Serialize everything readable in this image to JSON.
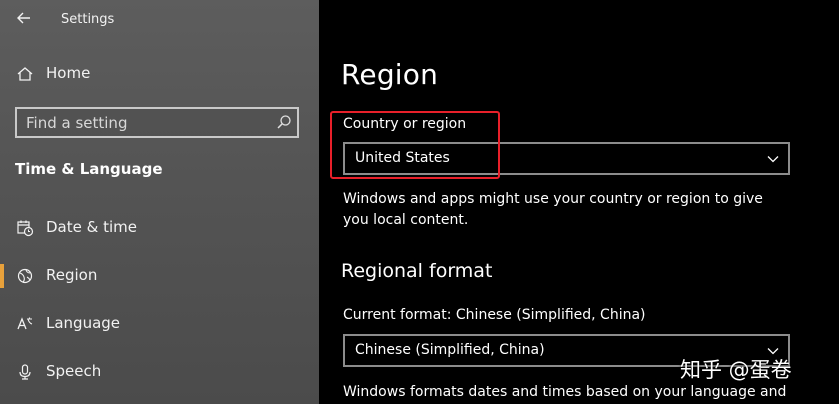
{
  "window": {
    "title": "Settings"
  },
  "sidebar": {
    "home_label": "Home",
    "search_placeholder": "Find a setting",
    "section_heading": "Time & Language",
    "items": [
      {
        "label": "Date & time",
        "icon": "calendar-clock-icon"
      },
      {
        "label": "Region",
        "icon": "globe-icon",
        "active": true
      },
      {
        "label": "Language",
        "icon": "language-icon"
      },
      {
        "label": "Speech",
        "icon": "microphone-icon"
      }
    ]
  },
  "main": {
    "title": "Region",
    "country": {
      "label": "Country or region",
      "value": "United States",
      "description": "Windows and apps might use your country or region to give you local content."
    },
    "regional_format": {
      "heading": "Regional format",
      "current_label": "Current format: Chinese (Simplified, China)",
      "value": "Chinese (Simplified, China)",
      "description": "Windows formats dates and times based on your language and"
    }
  },
  "watermark": "知乎 @蛋卷",
  "colors": {
    "sidebar_bg": "#555555",
    "main_bg": "#000000",
    "accent": "#e8a13b",
    "highlight": "#e8202a",
    "dropdown_border": "#8c8c8c"
  }
}
